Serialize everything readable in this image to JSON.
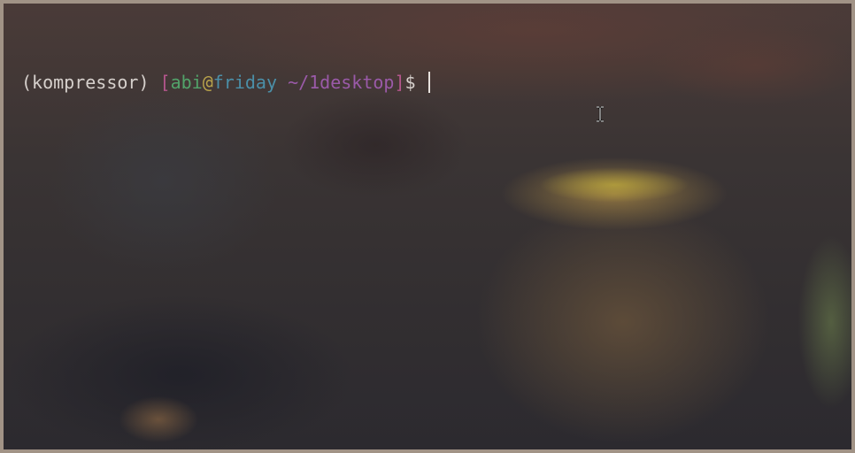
{
  "terminal": {
    "venv": "(kompressor)",
    "open_bracket": "[",
    "user": "abi",
    "at": "@",
    "host": "friday",
    "path": "~/1desktop",
    "close_bracket": "]",
    "dollar": "$",
    "input": ""
  },
  "colors": {
    "venv": "#d6d0cc",
    "bracket": "#b4568c",
    "user": "#52a36a",
    "at": "#b7a24b",
    "host": "#4b8fa8",
    "path": "#9a5aa8",
    "border": "#a19386"
  },
  "icons": {
    "mouse_cursor": "text-ibeam-cursor-icon"
  }
}
